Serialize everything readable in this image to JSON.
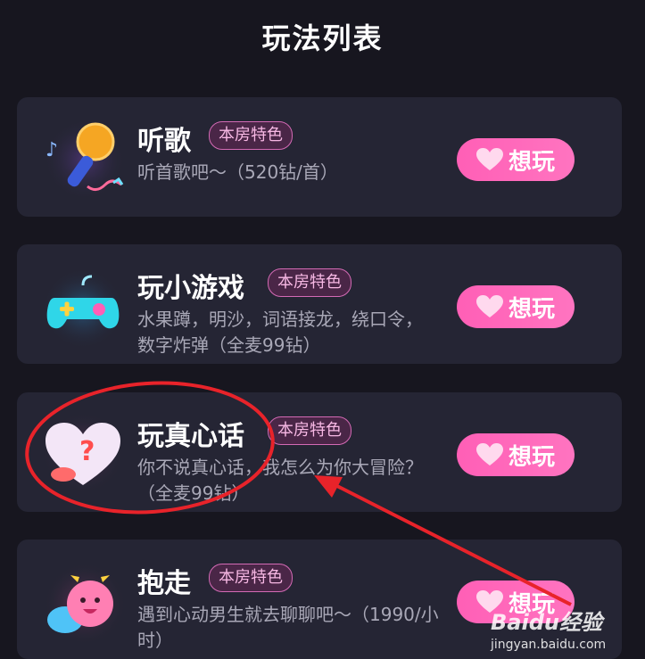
{
  "page": {
    "title": "玩法列表"
  },
  "colors": {
    "background": "#17161f",
    "card": "#252534",
    "accent": "#ff5fb6",
    "badge_border": "#d46ab5",
    "annotation": "#e8232a"
  },
  "games": [
    {
      "name": "听歌",
      "badge": "本房特色",
      "desc": "听首歌吧～（520钻/首）",
      "button": "想玩",
      "icon": "microphone-icon"
    },
    {
      "name": "玩小游戏",
      "badge": "本房特色",
      "desc": "水果蹲，明沙，词语接龙，绕口令，数字炸弹（全麦99钻）",
      "button": "想玩",
      "icon": "gamepad-icon"
    },
    {
      "name": "玩真心话",
      "badge": "本房特色",
      "desc": "你不说真心话，我怎么为你大冒险？（全麦99钻）",
      "button": "想玩",
      "icon": "heart-question-icon"
    },
    {
      "name": "抱走",
      "badge": "本房特色",
      "desc": "遇到心动男生就去聊聊吧～（1990/小时）",
      "button": "想玩",
      "icon": "cute-face-icon"
    }
  ],
  "watermark": {
    "brand": "Baidu经验",
    "url": "jingyan.baidu.com"
  }
}
